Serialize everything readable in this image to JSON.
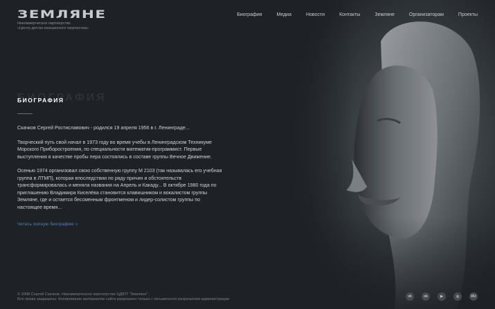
{
  "header": {
    "logo": "ЗЕМЛЯНЕ",
    "tagline_1": "Некоммерческое партнерство",
    "tagline_2": "«Центр детско-юношеского творчества»",
    "nav": [
      "Биография",
      "Медиа",
      "Новости",
      "Контакты",
      "Земляне",
      "Организаторам",
      "Проекты"
    ]
  },
  "main": {
    "title_ghost": "БИОГРАФИЯ",
    "title": "БИОГРАФИЯ",
    "paragraphs": [
      "Скачков Сергей Ростиславович - родился 19 апреля 1956 в г. Ленинграде...",
      "Творческий путь свой начал в 1973 году во время учебы в Ленинградском Техникуме Морского Приборостроения, по специальности математик-программист. Первые выступления в качестве пробы пера состоялись в составе группы Вечное Движение.",
      "Осенью 1974 организовал свою собственную группу М 2103 (так называлась его учебная группа в ЛТМП), которая впоследствии по ряду причин и обстоятельств трансформировалась и меняла названия на Апрель и Какаду... В октябре 1980 года по приглашению Владимира Киселёва становится клавишником и вокалистом группы Земляне, где и остается бессменным фронтменом и лидер-солистом группы по настоящее время..."
    ],
    "read_more": "Читать полную биографию »"
  },
  "footer": {
    "line_1": "© 2008 Сергей Скачков. Некоммерческое партнерство ЦДЮТ \"Земляне\".",
    "line_2": "Все права защищены. Копирование материалов сайта разрешено только с письменного разрешения администрации"
  },
  "social": [
    {
      "icon": "vk-icon",
      "glyph": "vk"
    },
    {
      "icon": "odnoklassniki-icon",
      "glyph": "ok"
    },
    {
      "icon": "youtube-icon",
      "glyph": "▶"
    },
    {
      "icon": "instagram-icon",
      "glyph": "◎"
    },
    {
      "icon": "rutube-icon",
      "glyph": "RU"
    }
  ],
  "colors": {
    "background": "#1e2226",
    "link": "#5a85c0",
    "heading": "#ffffff"
  }
}
